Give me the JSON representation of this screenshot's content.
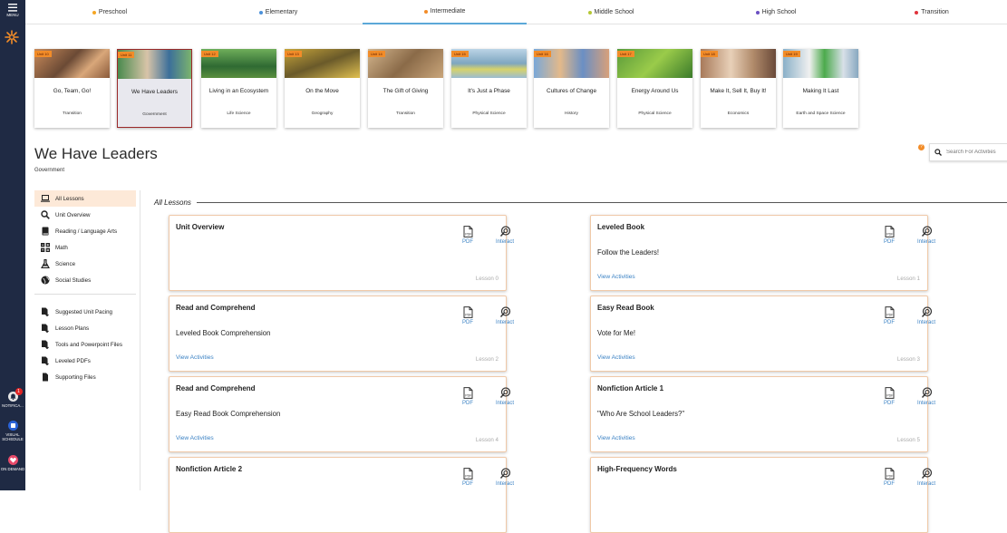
{
  "leftbar": {
    "menu_label": "MENU",
    "notifications_label": "NOTIFICA...",
    "notifications_count": "1",
    "visual_schedule_label": "VISUAL SCHEDULE",
    "on_demand_label": "ON DEMAND"
  },
  "levels": [
    {
      "label": "Preschool",
      "color": "#f5a623"
    },
    {
      "label": "Elementary",
      "color": "#4a90d9"
    },
    {
      "label": "Intermediate",
      "color": "#f28c28",
      "active": true
    },
    {
      "label": "Middle School",
      "color": "#b5c734"
    },
    {
      "label": "High School",
      "color": "#6a4fc2"
    },
    {
      "label": "Transition",
      "color": "#e0333c"
    }
  ],
  "units": [
    {
      "tag": "Unit 10",
      "title": "Go, Team, Go!",
      "subject": "Transition"
    },
    {
      "tag": "Unit 11",
      "title": "We Have Leaders",
      "subject": "Government",
      "selected": true
    },
    {
      "tag": "Unit 12",
      "title": "Living in an Ecosystem",
      "subject": "Life Science"
    },
    {
      "tag": "Unit 13",
      "title": "On the Move",
      "subject": "Geography"
    },
    {
      "tag": "Unit 14",
      "title": "The Gift of Giving",
      "subject": "Transition"
    },
    {
      "tag": "Unit 15",
      "title": "It's Just a Phase",
      "subject": "Physical Science"
    },
    {
      "tag": "Unit 16",
      "title": "Cultures of Change",
      "subject": "History"
    },
    {
      "tag": "Unit 17",
      "title": "Energy Around Us",
      "subject": "Physical Science"
    },
    {
      "tag": "Unit 18",
      "title": "Make It, Sell It, Buy It!",
      "subject": "Economics"
    },
    {
      "tag": "Unit 19",
      "title": "Making It Last",
      "subject": "Earth and Space Science"
    }
  ],
  "page": {
    "title": "We Have Leaders",
    "subtitle": "Government",
    "help": "?",
    "search_placeholder": "Search For Activities"
  },
  "sidenav": {
    "primary": [
      {
        "label": "All Lessons",
        "icon": "laptop-icon"
      },
      {
        "label": "Unit Overview",
        "icon": "search-icon"
      },
      {
        "label": "Reading / Language Arts",
        "icon": "book-icon"
      },
      {
        "label": "Math",
        "icon": "math-icon"
      },
      {
        "label": "Science",
        "icon": "flask-icon"
      },
      {
        "label": "Social Studies",
        "icon": "globe-icon"
      }
    ],
    "secondary": [
      {
        "label": "Suggested Unit Pacing",
        "icon": "file-download-icon"
      },
      {
        "label": "Lesson Plans",
        "icon": "file-download-icon"
      },
      {
        "label": "Tools and Powerpoint Files",
        "icon": "file-download-icon"
      },
      {
        "label": "Leveled PDFs",
        "icon": "file-download-icon"
      },
      {
        "label": "Supporting Files",
        "icon": "file-download-icon"
      }
    ]
  },
  "content": {
    "heading": "All Lessons",
    "pdf_label": "PDF",
    "interact_label": "Interact",
    "view_activities": "View Activities",
    "cards": [
      {
        "title": "Unit Overview",
        "subtitle": "",
        "lesson": "Lesson 0",
        "has_activities": false
      },
      {
        "title": "Leveled Book",
        "subtitle": "Follow the Leaders!",
        "lesson": "Lesson 1",
        "has_activities": true
      },
      {
        "title": "Read and Comprehend",
        "subtitle": "Leveled Book Comprehension",
        "lesson": "Lesson 2",
        "has_activities": true
      },
      {
        "title": "Easy Read Book",
        "subtitle": "Vote for Me!",
        "lesson": "Lesson 3",
        "has_activities": true
      },
      {
        "title": "Read and Comprehend",
        "subtitle": "Easy Read Book Comprehension",
        "lesson": "Lesson 4",
        "has_activities": true
      },
      {
        "title": "Nonfiction Article 1",
        "subtitle": "\"Who Are School Leaders?\"",
        "lesson": "Lesson 5",
        "has_activities": true
      },
      {
        "title": "Nonfiction Article 2",
        "subtitle": "",
        "lesson": "",
        "has_activities": false
      },
      {
        "title": "High-Frequency Words",
        "subtitle": "",
        "lesson": "",
        "has_activities": false
      }
    ]
  }
}
